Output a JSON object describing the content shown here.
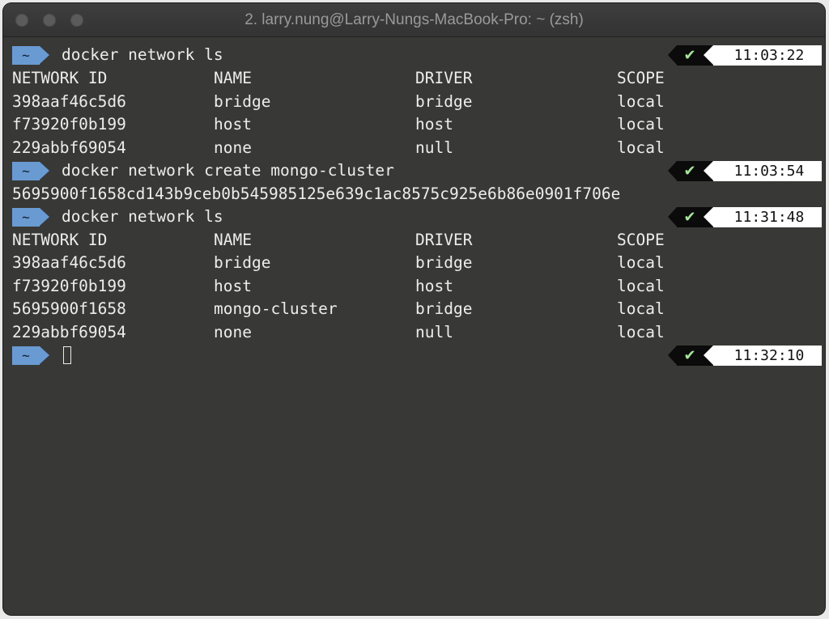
{
  "window": {
    "title": "2. larry.nung@Larry-Nungs-MacBook-Pro: ~ (zsh)"
  },
  "prompt": {
    "dir": "~",
    "status_symbol": "✔"
  },
  "blocks": [
    {
      "command": "docker network ls",
      "time": "11:03:22",
      "table": {
        "headers": [
          "NETWORK ID",
          "NAME",
          "DRIVER",
          "SCOPE"
        ],
        "rows": [
          [
            "398aaf46c5d6",
            "bridge",
            "bridge",
            "local"
          ],
          [
            "f73920f0b199",
            "host",
            "host",
            "local"
          ],
          [
            "229abbf69054",
            "none",
            "null",
            "local"
          ]
        ]
      }
    },
    {
      "command": "docker network create mongo-cluster",
      "time": "11:03:54",
      "output": "5695900f1658cd143b9ceb0b545985125e639c1ac8575c925e6b86e0901f706e"
    },
    {
      "command": "docker network ls",
      "time": "11:31:48",
      "table": {
        "headers": [
          "NETWORK ID",
          "NAME",
          "DRIVER",
          "SCOPE"
        ],
        "rows": [
          [
            "398aaf46c5d6",
            "bridge",
            "bridge",
            "local"
          ],
          [
            "f73920f0b199",
            "host",
            "host",
            "local"
          ],
          [
            "5695900f1658",
            "mongo-cluster",
            "bridge",
            "local"
          ],
          [
            "229abbf69054",
            "none",
            "null",
            "local"
          ]
        ]
      }
    },
    {
      "command": "",
      "time": "11:32:10"
    }
  ],
  "colors": {
    "terminal_bg": "#383836",
    "prompt_badge": "#6a9ad2",
    "check": "#a7e49b",
    "time_bg": "#ffffff"
  }
}
